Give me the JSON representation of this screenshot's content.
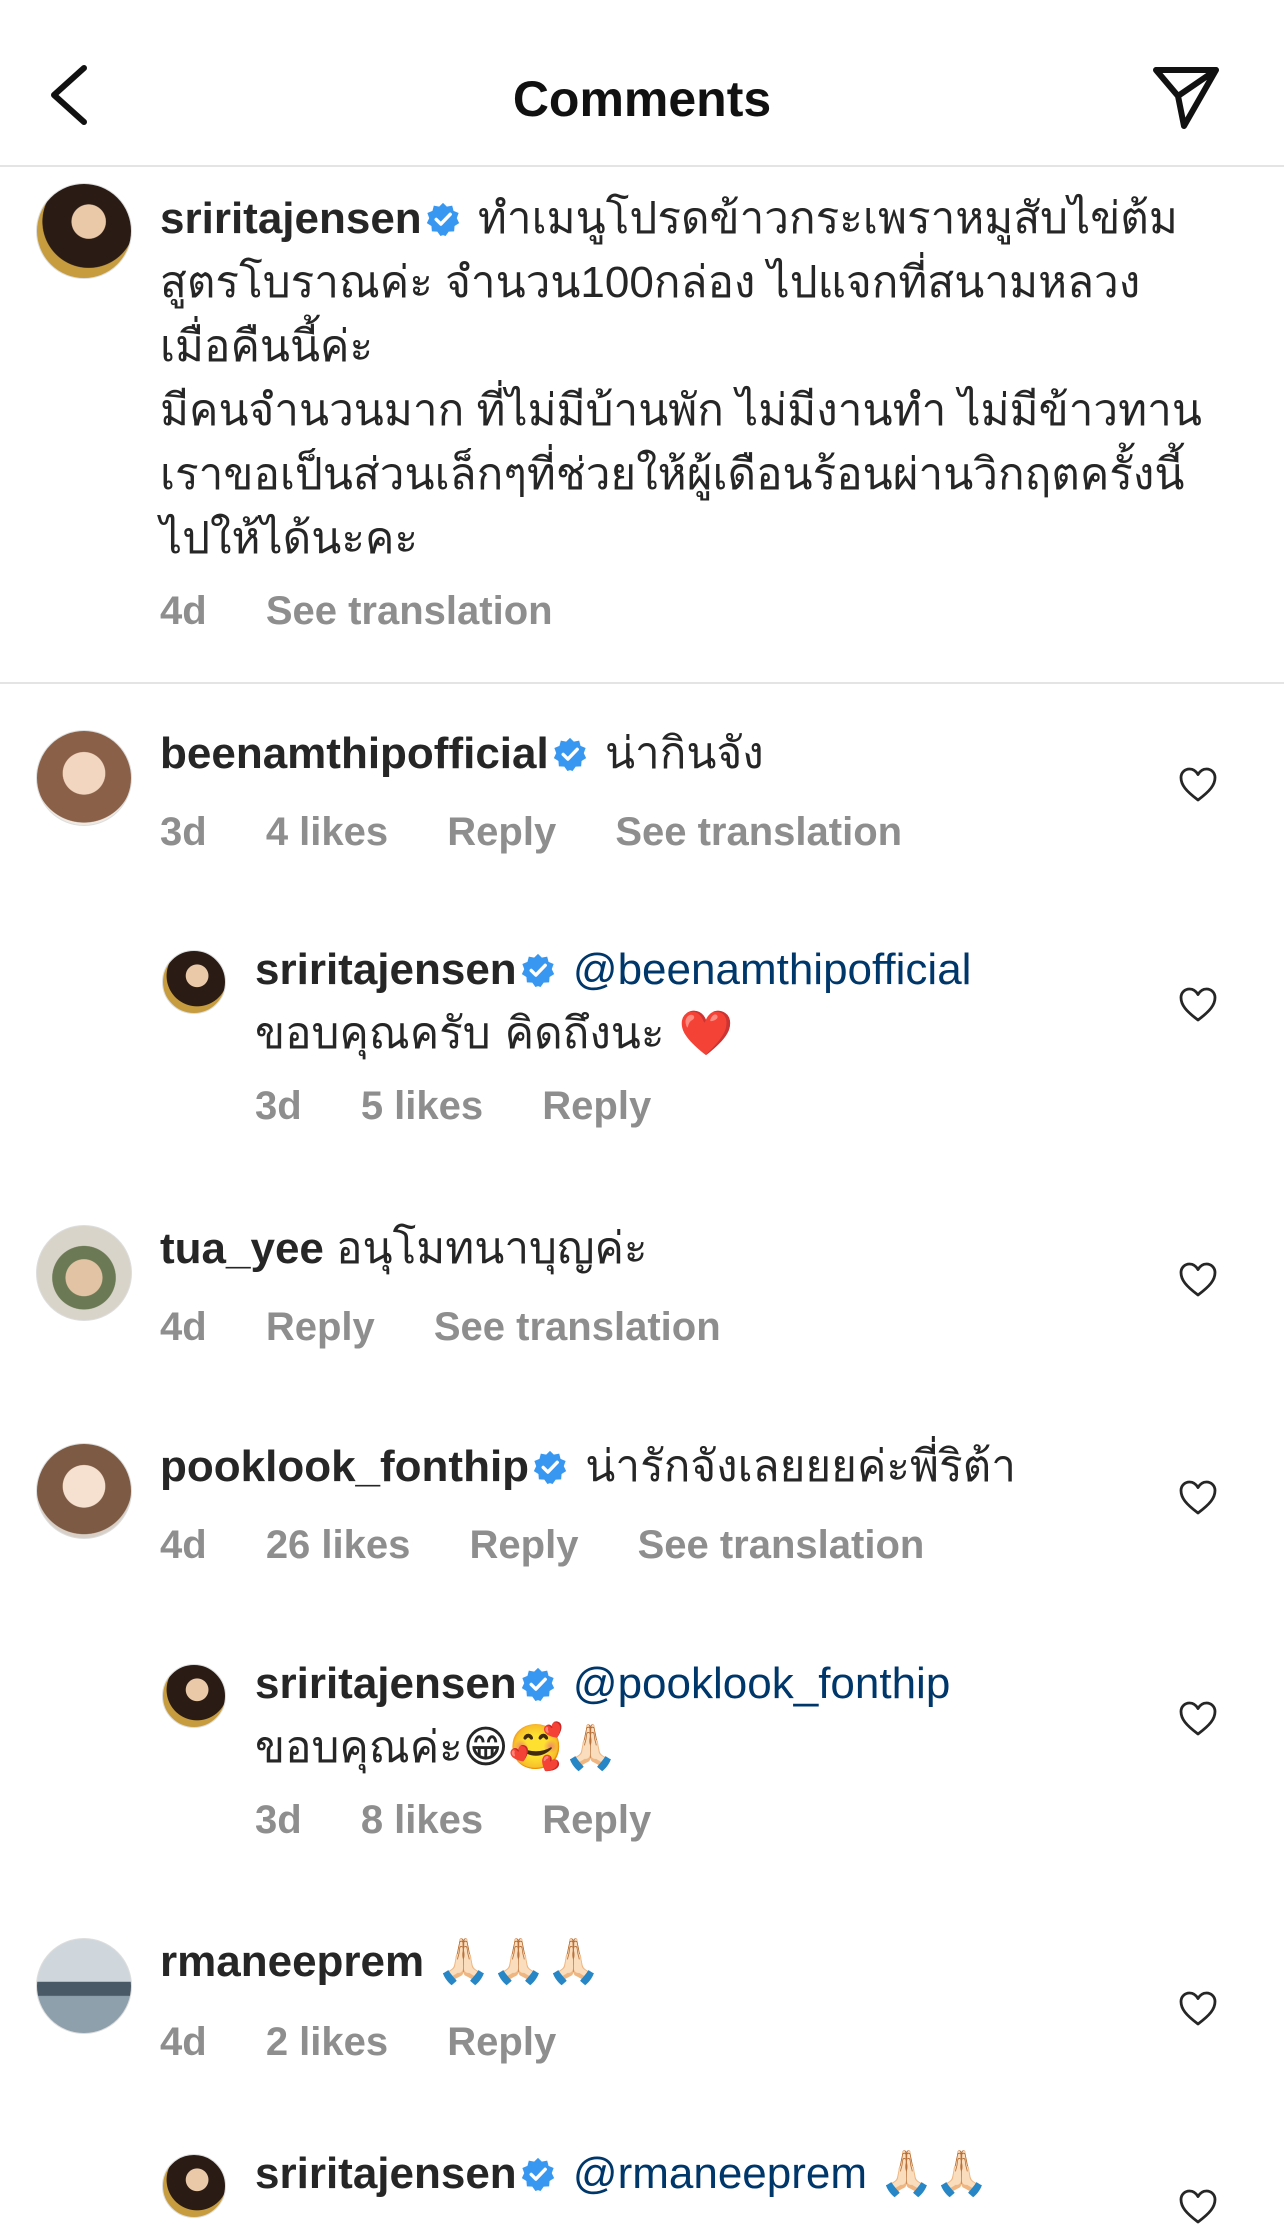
{
  "header": {
    "title": "Comments"
  },
  "caption": {
    "username": "sriritajensen",
    "lines": [
      "ทำเมนูโปรดข้าวกระเพราหมูสับไข่ต้ม",
      "สูตรโบราณค่ะ จำนวน100กล่อง ไปแจกที่สนามหลวง",
      "เมื่อคืนนี้ค่ะ",
      "มีคนจำนวนมาก ที่ไม่มีบ้านพัก ไม่มีงานทำ ไม่มีข้าวทาน",
      "เราขอเป็นส่วนเล็กๆที่ช่วยให้ผู้เดือนร้อนผ่านวิกฤตครั้งนี้",
      "ไปให้ได้นะคะ"
    ],
    "time": "4d",
    "see_translation": "See translation"
  },
  "comments": [
    {
      "username": "beenamthipofficial",
      "verified": true,
      "text": "น่ากินจัง",
      "time": "3d",
      "likes": "4 likes",
      "reply": "Reply",
      "see_translation": "See translation"
    },
    {
      "username": "sriritajensen",
      "verified": true,
      "mention": "@beenamthipofficial",
      "text": "ขอบคุณครับ คิดถึงนะ ❤️",
      "time": "3d",
      "likes": "5 likes",
      "reply": "Reply"
    },
    {
      "username": "tua_yee",
      "verified": false,
      "text": "อนุโมทนาบุญค่ะ",
      "time": "4d",
      "reply": "Reply",
      "see_translation": "See translation"
    },
    {
      "username": "pooklook_fonthip",
      "verified": true,
      "text": "น่ารักจังเลยยยค่ะพี่ริต้า",
      "time": "4d",
      "likes": "26 likes",
      "reply": "Reply",
      "see_translation": "See translation"
    },
    {
      "username": "sriritajensen",
      "verified": true,
      "mention": "@pooklook_fonthip",
      "text": "ขอบคุณค่ะ😁🥰🙏🏻",
      "time": "3d",
      "likes": "8 likes",
      "reply": "Reply"
    },
    {
      "username": "rmaneeprem",
      "verified": false,
      "text": "🙏🏻🙏🏻🙏🏻",
      "time": "4d",
      "likes": "2 likes",
      "reply": "Reply"
    },
    {
      "username": "sriritajensen",
      "verified": true,
      "mention": "@rmaneeprem",
      "text": "🙏🏻🙏🏻"
    }
  ],
  "colors": {
    "verified_badge": "#3897f0",
    "mention": "#00376b",
    "meta_text": "#8e8e8e",
    "divider": "#e4e4e4"
  },
  "icons": {
    "back": "chevron-left-icon",
    "send": "paper-plane-icon",
    "like": "heart-outline-icon",
    "verified": "verified-badge-icon"
  }
}
